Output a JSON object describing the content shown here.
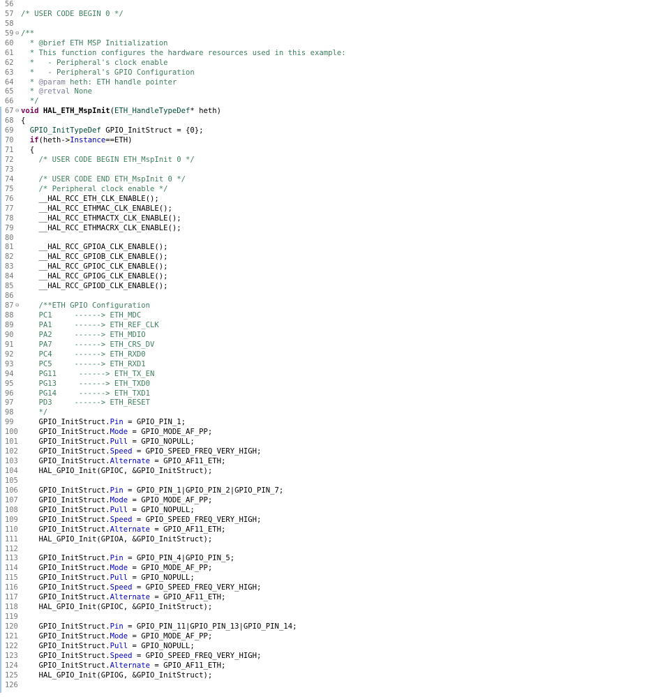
{
  "editor": {
    "colors": {
      "comment": "#3f7f5f",
      "keyword": "#7f0055",
      "type": "#005032",
      "field": "#0000c0",
      "line_number": "#787878",
      "change_bar": "#a6c8e8"
    },
    "lines": [
      {
        "n": "56",
        "fold": "",
        "segs": []
      },
      {
        "n": "57",
        "fold": "",
        "segs": [
          {
            "c": "cm",
            "t": "/* USER CODE BEGIN 0 */"
          }
        ]
      },
      {
        "n": "58",
        "fold": "",
        "segs": []
      },
      {
        "n": "59",
        "fold": "⊖",
        "segs": [
          {
            "c": "cm",
            "t": "/**"
          }
        ]
      },
      {
        "n": "60",
        "fold": "",
        "segs": [
          {
            "c": "cm",
            "t": "  * @brief ETH MSP Initialization"
          }
        ]
      },
      {
        "n": "61",
        "fold": "",
        "segs": [
          {
            "c": "cm",
            "t": "  * This function configures the hardware resources used in this example:"
          }
        ]
      },
      {
        "n": "62",
        "fold": "",
        "segs": [
          {
            "c": "cm",
            "t": "  *   - Peripheral's clock enable"
          }
        ]
      },
      {
        "n": "63",
        "fold": "",
        "segs": [
          {
            "c": "cm",
            "t": "  *   - Peripheral's GPIO Configuration"
          }
        ]
      },
      {
        "n": "64",
        "fold": "",
        "segs": [
          {
            "c": "cm",
            "t": "  * "
          },
          {
            "c": "tg",
            "t": "@param"
          },
          {
            "c": "cm",
            "t": " heth: ETH handle pointer"
          }
        ]
      },
      {
        "n": "65",
        "fold": "",
        "segs": [
          {
            "c": "cm",
            "t": "  * "
          },
          {
            "c": "tg",
            "t": "@retval"
          },
          {
            "c": "cm",
            "t": " None"
          }
        ]
      },
      {
        "n": "66",
        "fold": "",
        "segs": [
          {
            "c": "cm",
            "t": "  */"
          }
        ]
      },
      {
        "n": "67",
        "fold": "⊖",
        "segs": [
          {
            "c": "kw",
            "t": "void"
          },
          {
            "c": "",
            "t": " "
          },
          {
            "c": "fn",
            "t": "HAL_ETH_MspInit"
          },
          {
            "c": "",
            "t": "("
          },
          {
            "c": "ty",
            "t": "ETH_HandleTypeDef"
          },
          {
            "c": "",
            "t": "* heth)"
          }
        ]
      },
      {
        "n": "68",
        "fold": "",
        "segs": [
          {
            "c": "",
            "t": "{"
          }
        ]
      },
      {
        "n": "69",
        "fold": "",
        "segs": [
          {
            "c": "",
            "t": "  "
          },
          {
            "c": "ty",
            "t": "GPIO_InitTypeDef"
          },
          {
            "c": "",
            "t": " GPIO_InitStruct = {0};"
          }
        ]
      },
      {
        "n": "70",
        "fold": "",
        "segs": [
          {
            "c": "",
            "t": "  "
          },
          {
            "c": "kw",
            "t": "if"
          },
          {
            "c": "",
            "t": "(heth->"
          },
          {
            "c": "fd",
            "t": "Instance"
          },
          {
            "c": "",
            "t": "==ETH)"
          }
        ]
      },
      {
        "n": "71",
        "fold": "",
        "segs": [
          {
            "c": "",
            "t": "  {"
          }
        ]
      },
      {
        "n": "72",
        "fold": "",
        "segs": [
          {
            "c": "",
            "t": "    "
          },
          {
            "c": "cm",
            "t": "/* USER CODE BEGIN ETH_MspInit 0 */"
          }
        ]
      },
      {
        "n": "73",
        "fold": "",
        "segs": []
      },
      {
        "n": "74",
        "fold": "",
        "segs": [
          {
            "c": "",
            "t": "    "
          },
          {
            "c": "cm",
            "t": "/* USER CODE END ETH_MspInit 0 */"
          }
        ]
      },
      {
        "n": "75",
        "fold": "",
        "segs": [
          {
            "c": "",
            "t": "    "
          },
          {
            "c": "cm",
            "t": "/* Peripheral clock enable */"
          }
        ]
      },
      {
        "n": "76",
        "fold": "",
        "segs": [
          {
            "c": "",
            "t": "    __HAL_RCC_ETH_CLK_ENABLE();"
          }
        ]
      },
      {
        "n": "77",
        "fold": "",
        "segs": [
          {
            "c": "",
            "t": "    __HAL_RCC_ETHMAC_CLK_ENABLE();"
          }
        ]
      },
      {
        "n": "78",
        "fold": "",
        "segs": [
          {
            "c": "",
            "t": "    __HAL_RCC_ETHMACTX_CLK_ENABLE();"
          }
        ]
      },
      {
        "n": "79",
        "fold": "",
        "segs": [
          {
            "c": "",
            "t": "    __HAL_RCC_ETHMACRX_CLK_ENABLE();"
          }
        ]
      },
      {
        "n": "80",
        "fold": "",
        "segs": []
      },
      {
        "n": "81",
        "fold": "",
        "segs": [
          {
            "c": "",
            "t": "    __HAL_RCC_GPIOA_CLK_ENABLE();"
          }
        ]
      },
      {
        "n": "82",
        "fold": "",
        "segs": [
          {
            "c": "",
            "t": "    __HAL_RCC_GPIOB_CLK_ENABLE();"
          }
        ]
      },
      {
        "n": "83",
        "fold": "",
        "segs": [
          {
            "c": "",
            "t": "    __HAL_RCC_GPIOC_CLK_ENABLE();"
          }
        ]
      },
      {
        "n": "84",
        "fold": "",
        "segs": [
          {
            "c": "",
            "t": "    __HAL_RCC_GPIOG_CLK_ENABLE();"
          }
        ]
      },
      {
        "n": "85",
        "fold": "",
        "segs": [
          {
            "c": "",
            "t": "    __HAL_RCC_GPIOD_CLK_ENABLE();"
          }
        ]
      },
      {
        "n": "86",
        "fold": "",
        "segs": []
      },
      {
        "n": "87",
        "fold": "⊖",
        "segs": [
          {
            "c": "",
            "t": "    "
          },
          {
            "c": "cm",
            "t": "/**ETH GPIO Configuration"
          }
        ]
      },
      {
        "n": "88",
        "fold": "",
        "segs": [
          {
            "c": "cm",
            "t": "    PC1     ------> ETH_MDC"
          }
        ]
      },
      {
        "n": "89",
        "fold": "",
        "segs": [
          {
            "c": "cm",
            "t": "    PA1     ------> ETH_REF_CLK"
          }
        ]
      },
      {
        "n": "90",
        "fold": "",
        "segs": [
          {
            "c": "cm",
            "t": "    PA2     ------> ETH_MDIO"
          }
        ]
      },
      {
        "n": "91",
        "fold": "",
        "segs": [
          {
            "c": "cm",
            "t": "    PA7     ------> ETH_CRS_DV"
          }
        ]
      },
      {
        "n": "92",
        "fold": "",
        "segs": [
          {
            "c": "cm",
            "t": "    PC4     ------> ETH_RXD0"
          }
        ]
      },
      {
        "n": "93",
        "fold": "",
        "segs": [
          {
            "c": "cm",
            "t": "    PC5     ------> ETH_RXD1"
          }
        ]
      },
      {
        "n": "94",
        "fold": "",
        "segs": [
          {
            "c": "cm",
            "t": "    PG11     ------> ETH_TX_EN"
          }
        ]
      },
      {
        "n": "95",
        "fold": "",
        "segs": [
          {
            "c": "cm",
            "t": "    PG13     ------> ETH_TXD0"
          }
        ]
      },
      {
        "n": "96",
        "fold": "",
        "segs": [
          {
            "c": "cm",
            "t": "    PG14     ------> ETH_TXD1"
          }
        ]
      },
      {
        "n": "97",
        "fold": "",
        "segs": [
          {
            "c": "cm",
            "t": "    PD3     ------> ETH_RESET"
          }
        ]
      },
      {
        "n": "98",
        "fold": "",
        "segs": [
          {
            "c": "cm",
            "t": "    */"
          }
        ]
      },
      {
        "n": "99",
        "fold": "",
        "segs": [
          {
            "c": "",
            "t": "    GPIO_InitStruct."
          },
          {
            "c": "fd",
            "t": "Pin"
          },
          {
            "c": "",
            "t": " = GPIO_PIN_1;"
          }
        ]
      },
      {
        "n": "100",
        "fold": "",
        "segs": [
          {
            "c": "",
            "t": "    GPIO_InitStruct."
          },
          {
            "c": "fd",
            "t": "Mode"
          },
          {
            "c": "",
            "t": " = GPIO_MODE_AF_PP;"
          }
        ]
      },
      {
        "n": "101",
        "fold": "",
        "segs": [
          {
            "c": "",
            "t": "    GPIO_InitStruct."
          },
          {
            "c": "fd",
            "t": "Pull"
          },
          {
            "c": "",
            "t": " = GPIO_NOPULL;"
          }
        ]
      },
      {
        "n": "102",
        "fold": "",
        "segs": [
          {
            "c": "",
            "t": "    GPIO_InitStruct."
          },
          {
            "c": "fd",
            "t": "Speed"
          },
          {
            "c": "",
            "t": " = GPIO_SPEED_FREQ_VERY_HIGH;"
          }
        ]
      },
      {
        "n": "103",
        "fold": "",
        "segs": [
          {
            "c": "",
            "t": "    GPIO_InitStruct."
          },
          {
            "c": "fd",
            "t": "Alternate"
          },
          {
            "c": "",
            "t": " = GPIO_AF11_ETH;"
          }
        ]
      },
      {
        "n": "104",
        "fold": "",
        "segs": [
          {
            "c": "",
            "t": "    HAL_GPIO_Init(GPIOC, &GPIO_InitStruct);"
          }
        ]
      },
      {
        "n": "105",
        "fold": "",
        "segs": []
      },
      {
        "n": "106",
        "fold": "",
        "segs": [
          {
            "c": "",
            "t": "    GPIO_InitStruct."
          },
          {
            "c": "fd",
            "t": "Pin"
          },
          {
            "c": "",
            "t": " = GPIO_PIN_1|GPIO_PIN_2|GPIO_PIN_7;"
          }
        ]
      },
      {
        "n": "107",
        "fold": "",
        "segs": [
          {
            "c": "",
            "t": "    GPIO_InitStruct."
          },
          {
            "c": "fd",
            "t": "Mode"
          },
          {
            "c": "",
            "t": " = GPIO_MODE_AF_PP;"
          }
        ]
      },
      {
        "n": "108",
        "fold": "",
        "segs": [
          {
            "c": "",
            "t": "    GPIO_InitStruct."
          },
          {
            "c": "fd",
            "t": "Pull"
          },
          {
            "c": "",
            "t": " = GPIO_NOPULL;"
          }
        ]
      },
      {
        "n": "109",
        "fold": "",
        "segs": [
          {
            "c": "",
            "t": "    GPIO_InitStruct."
          },
          {
            "c": "fd",
            "t": "Speed"
          },
          {
            "c": "",
            "t": " = GPIO_SPEED_FREQ_VERY_HIGH;"
          }
        ]
      },
      {
        "n": "110",
        "fold": "",
        "segs": [
          {
            "c": "",
            "t": "    GPIO_InitStruct."
          },
          {
            "c": "fd",
            "t": "Alternate"
          },
          {
            "c": "",
            "t": " = GPIO_AF11_ETH;"
          }
        ]
      },
      {
        "n": "111",
        "fold": "",
        "segs": [
          {
            "c": "",
            "t": "    HAL_GPIO_Init(GPIOA, &GPIO_InitStruct);"
          }
        ]
      },
      {
        "n": "112",
        "fold": "",
        "segs": []
      },
      {
        "n": "113",
        "fold": "",
        "segs": [
          {
            "c": "",
            "t": "    GPIO_InitStruct."
          },
          {
            "c": "fd",
            "t": "Pin"
          },
          {
            "c": "",
            "t": " = GPIO_PIN_4|GPIO_PIN_5;"
          }
        ]
      },
      {
        "n": "114",
        "fold": "",
        "segs": [
          {
            "c": "",
            "t": "    GPIO_InitStruct."
          },
          {
            "c": "fd",
            "t": "Mode"
          },
          {
            "c": "",
            "t": " = GPIO_MODE_AF_PP;"
          }
        ]
      },
      {
        "n": "115",
        "fold": "",
        "segs": [
          {
            "c": "",
            "t": "    GPIO_InitStruct."
          },
          {
            "c": "fd",
            "t": "Pull"
          },
          {
            "c": "",
            "t": " = GPIO_NOPULL;"
          }
        ]
      },
      {
        "n": "116",
        "fold": "",
        "segs": [
          {
            "c": "",
            "t": "    GPIO_InitStruct."
          },
          {
            "c": "fd",
            "t": "Speed"
          },
          {
            "c": "",
            "t": " = GPIO_SPEED_FREQ_VERY_HIGH;"
          }
        ]
      },
      {
        "n": "117",
        "fold": "",
        "segs": [
          {
            "c": "",
            "t": "    GPIO_InitStruct."
          },
          {
            "c": "fd",
            "t": "Alternate"
          },
          {
            "c": "",
            "t": " = GPIO_AF11_ETH;"
          }
        ]
      },
      {
        "n": "118",
        "fold": "",
        "segs": [
          {
            "c": "",
            "t": "    HAL_GPIO_Init(GPIOC, &GPIO_InitStruct);"
          }
        ]
      },
      {
        "n": "119",
        "fold": "",
        "segs": []
      },
      {
        "n": "120",
        "fold": "",
        "segs": [
          {
            "c": "",
            "t": "    GPIO_InitStruct."
          },
          {
            "c": "fd",
            "t": "Pin"
          },
          {
            "c": "",
            "t": " = GPIO_PIN_11|GPIO_PIN_13|GPIO_PIN_14;"
          }
        ]
      },
      {
        "n": "121",
        "fold": "",
        "segs": [
          {
            "c": "",
            "t": "    GPIO_InitStruct."
          },
          {
            "c": "fd",
            "t": "Mode"
          },
          {
            "c": "",
            "t": " = GPIO_MODE_AF_PP;"
          }
        ]
      },
      {
        "n": "122",
        "fold": "",
        "segs": [
          {
            "c": "",
            "t": "    GPIO_InitStruct."
          },
          {
            "c": "fd",
            "t": "Pull"
          },
          {
            "c": "",
            "t": " = GPIO_NOPULL;"
          }
        ]
      },
      {
        "n": "123",
        "fold": "",
        "segs": [
          {
            "c": "",
            "t": "    GPIO_InitStruct."
          },
          {
            "c": "fd",
            "t": "Speed"
          },
          {
            "c": "",
            "t": " = GPIO_SPEED_FREQ_VERY_HIGH;"
          }
        ]
      },
      {
        "n": "124",
        "fold": "",
        "segs": [
          {
            "c": "",
            "t": "    GPIO_InitStruct."
          },
          {
            "c": "fd",
            "t": "Alternate"
          },
          {
            "c": "",
            "t": " = GPIO_AF11_ETH;"
          }
        ]
      },
      {
        "n": "125",
        "fold": "",
        "segs": [
          {
            "c": "",
            "t": "    HAL_GPIO_Init(GPIOG, &GPIO_InitStruct);"
          }
        ]
      },
      {
        "n": "126",
        "fold": "",
        "segs": []
      }
    ]
  }
}
